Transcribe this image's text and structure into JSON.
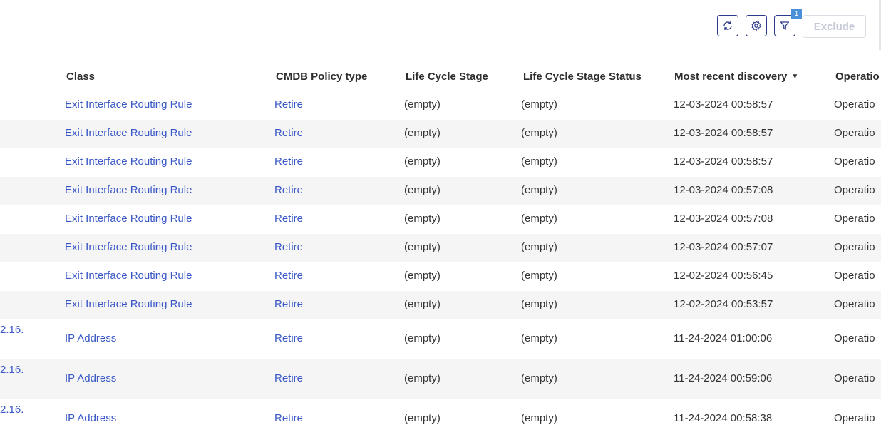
{
  "toolbar": {
    "refresh_icon": "refresh-icon",
    "settings_icon": "gear-icon",
    "filter_icon": "filter-icon",
    "filter_badge": "1",
    "exclude_label": "Exclude",
    "accent": "#2d3a8c",
    "badge_color": "#4a90d9"
  },
  "columns": {
    "class": "Class",
    "policy": "CMDB Policy type",
    "lcs": "Life Cycle Stage",
    "lcs_status": "Life Cycle Stage Status",
    "discovery": "Most recent discovery",
    "operational": "Operatio"
  },
  "sort": {
    "column": "Most recent discovery",
    "direction": "descending"
  },
  "link_color": "#3957c6",
  "rows": [
    {
      "prefix": "",
      "class": "Exit Interface Routing Rule",
      "policy": "Retire",
      "lcs": "(empty)",
      "lcs_status": "(empty)",
      "discovery": "12-03-2024 00:58:57",
      "operational": "Operatio"
    },
    {
      "prefix": "",
      "class": "Exit Interface Routing Rule",
      "policy": "Retire",
      "lcs": "(empty)",
      "lcs_status": "(empty)",
      "discovery": "12-03-2024 00:58:57",
      "operational": "Operatio"
    },
    {
      "prefix": "",
      "class": "Exit Interface Routing Rule",
      "policy": "Retire",
      "lcs": "(empty)",
      "lcs_status": "(empty)",
      "discovery": "12-03-2024 00:58:57",
      "operational": "Operatio"
    },
    {
      "prefix": "",
      "class": "Exit Interface Routing Rule",
      "policy": "Retire",
      "lcs": "(empty)",
      "lcs_status": "(empty)",
      "discovery": "12-03-2024 00:57:08",
      "operational": "Operatio"
    },
    {
      "prefix": "",
      "class": "Exit Interface Routing Rule",
      "policy": "Retire",
      "lcs": "(empty)",
      "lcs_status": "(empty)",
      "discovery": "12-03-2024 00:57:08",
      "operational": "Operatio"
    },
    {
      "prefix": "",
      "class": "Exit Interface Routing Rule",
      "policy": "Retire",
      "lcs": "(empty)",
      "lcs_status": "(empty)",
      "discovery": "12-03-2024 00:57:07",
      "operational": "Operatio"
    },
    {
      "prefix": "",
      "class": "Exit Interface Routing Rule",
      "policy": "Retire",
      "lcs": "(empty)",
      "lcs_status": "(empty)",
      "discovery": "12-02-2024 00:56:45",
      "operational": "Operatio"
    },
    {
      "prefix": "",
      "class": "Exit Interface Routing Rule",
      "policy": "Retire",
      "lcs": "(empty)",
      "lcs_status": "(empty)",
      "discovery": "12-02-2024 00:53:57",
      "operational": "Operatio"
    },
    {
      "prefix": "2.16.",
      "class": "IP Address",
      "policy": "Retire",
      "lcs": "(empty)",
      "lcs_status": "(empty)",
      "discovery": "11-24-2024 01:00:06",
      "operational": "Operatio"
    },
    {
      "prefix": "2.16.",
      "class": "IP Address",
      "policy": "Retire",
      "lcs": "(empty)",
      "lcs_status": "(empty)",
      "discovery": "11-24-2024 00:59:06",
      "operational": "Operatio"
    },
    {
      "prefix": "2.16.",
      "class": "IP Address",
      "policy": "Retire",
      "lcs": "(empty)",
      "lcs_status": "(empty)",
      "discovery": "11-24-2024 00:58:38",
      "operational": "Operatio"
    }
  ]
}
